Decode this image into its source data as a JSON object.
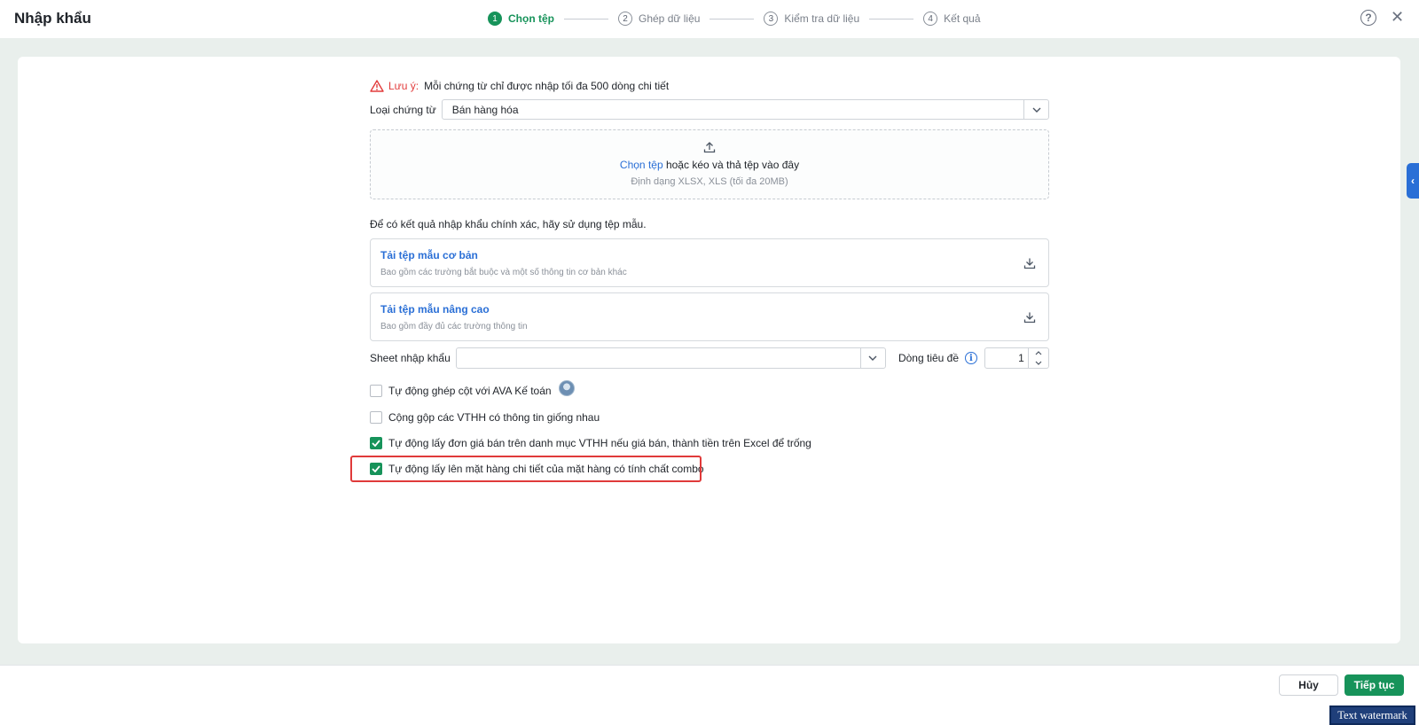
{
  "header": {
    "title": "Nhập khẩu",
    "steps": [
      {
        "num": "1",
        "label": "Chọn tệp"
      },
      {
        "num": "2",
        "label": "Ghép dữ liệu"
      },
      {
        "num": "3",
        "label": "Kiểm tra dữ liệu"
      },
      {
        "num": "4",
        "label": "Kết quả"
      }
    ],
    "active_step": 1,
    "help_icon": "help-circle-icon",
    "close_icon": "close-icon"
  },
  "note": {
    "label": "Lưu ý:",
    "text": "Mỗi chứng từ chỉ được nhập tối đa 500 dòng chi tiết"
  },
  "voucher_type": {
    "label": "Loại chứng từ",
    "value": "Bán hàng hóa"
  },
  "dropzone": {
    "link": "Chọn tệp",
    "text": " hoặc kéo và thả tệp vào đây",
    "format": "Định dạng XLSX, XLS (tối đa 20MB)"
  },
  "hint": "Để có kết quả nhập khẩu chính xác, hãy sử dụng tệp mẫu.",
  "templates": [
    {
      "title": "Tải tệp mẫu cơ bản",
      "desc": "Bao gồm các trường bắt buộc và một số thông tin cơ bản khác"
    },
    {
      "title": "Tải tệp mẫu nâng cao",
      "desc": "Bao gồm đầy đủ các trường thông tin"
    }
  ],
  "sheet": {
    "label": "Sheet nhập khẩu",
    "value": "",
    "header_row_label": "Dòng tiêu đề",
    "header_row_value": "1"
  },
  "options": [
    {
      "label": "Tự động ghép cột với AVA Kế toán",
      "checked": false
    },
    {
      "label": "Cộng gộp các VTHH có thông tin giống nhau",
      "checked": false
    },
    {
      "label": "Tự động lấy đơn giá bán trên danh mục VTHH nếu giá bán, thành tiền trên Excel để trống",
      "checked": true
    },
    {
      "label": "Tự động lấy lên mặt hàng chi tiết của mặt hàng có tính chất combo",
      "checked": true
    }
  ],
  "footer": {
    "cancel": "Hủy",
    "next": "Tiếp tục"
  },
  "watermark": "Text watermark",
  "colors": {
    "accent": "#17935a",
    "link": "#2a6fd6",
    "warning": "#e23b3b",
    "highlight": "#e03a3a"
  }
}
